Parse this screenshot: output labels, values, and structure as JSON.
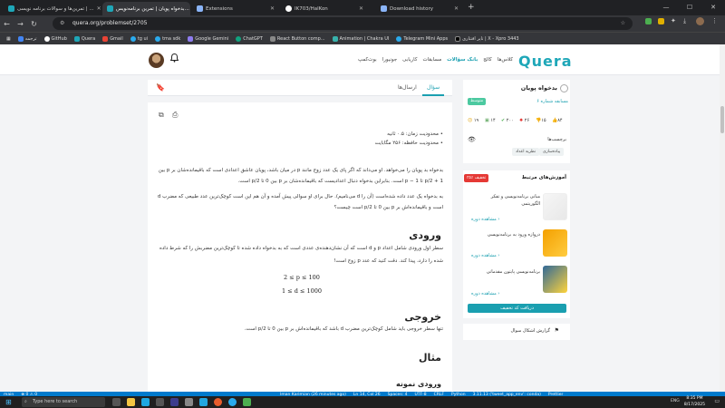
{
  "browser": {
    "tabs": [
      {
        "title": "تمرین‌ها و سوالات برنامه نویسی | ...",
        "color": "#1ea7b8"
      },
      {
        "title": "بدخواه پویان | تمرین برنامه‌نویس...",
        "color": "#1ea7b8"
      },
      {
        "title": "Extensions",
        "color": "#8ab4f8"
      },
      {
        "title": "IK703/HalKon",
        "color": "#ffffff"
      },
      {
        "title": "Download history",
        "color": "#8ab4f8"
      }
    ],
    "url": "quera.org/problemset/2705",
    "bookmarks": [
      "ترجمه",
      "GitHub",
      "Quera",
      "Gmail",
      "tg ui",
      "tma sdk",
      "Google Gemini",
      "ChatGPT",
      "React Button comp...",
      "Animation | Chakra UI",
      "Telegram Mini Apps",
      "تاپر افتتاری | X - Xpro 3443"
    ]
  },
  "site": {
    "logo": "Quera",
    "nav": [
      "کلاس‌ها",
      "کالج",
      "بانک سؤالات",
      "مسابقات",
      "کاریابی",
      "جونیورا",
      "بوت‌کمپ"
    ],
    "active_nav": "بانک سؤالات"
  },
  "problem_tabs": {
    "question": "سؤال",
    "submissions": "ارسال‌ها"
  },
  "problem": {
    "limits": [
      "محدودیت زمان: ۰.۵ ثانیه",
      "محدودیت حافظه: ۲۵۶ مگابایت"
    ],
    "statement_1": "بدخواه بد پویان را می‌خواهد. او می‌داند که اگر پای یک عدد زوج مانند p در میان باشد، پویان عاشق اعدادی است که باقیمانده‌شان بر p بین",
    "statement_1b": "1 + p/2 تا p − 1 است. بنابراین بدخواه دنبال اعدادیست که باقیمانده‌شان بر p بین 0 تا p/2 است.",
    "statement_2": "به بدخواه یک عدد داده شده‌است (آن را d می‌نامیم). حال برای او سوالی پیش آمده و آن هم این است کوچک‌ترین عدد طبیعی که مضرب d",
    "statement_2b": "است و باقیمانده‌اش بر p بین 0 تا p/2 است چیست؟",
    "input_title": "ورودی",
    "input_text": "سطر اول ورودی شامل اعداد p و d است که آن نشان‌دهنده‌ی عددی است که به بدخواه داده شده تا کوچک‌ترین مضربش را که شرط داده",
    "input_text_b": "شده را دارد، پیدا کند. دقت کنید که عدد p زوج است!",
    "constraint_1": "2 ≤ p ≤ 100",
    "constraint_2": "1 ≤ d ≤ 1000",
    "output_title": "خروجی",
    "output_text": "تنها سطر خروجی باید شامل کوچک‌ترین مضرب d باشد که باقیمانده‌اش بر p بین 0 تا p/2 است.",
    "example_title": "مثال",
    "sample_input_title": "ورودی نمونه"
  },
  "sidebar": {
    "problem_title": "بدخواه پویان",
    "contest": "مسابقه شماره ۶",
    "difficulty_badge": "متوسط",
    "stats": {
      "likes": "۸۴",
      "dislikes": "۱۵",
      "rating": "۲۶",
      "solved": "۲۰۰",
      "attempts": "۱۴",
      "reports": "۱۹"
    },
    "tags_title": "برچسب‌ها",
    "tags": [
      "نظریه اعداد",
      "پیاده‌سازی"
    ],
    "courses_title": "آموزش‌های مرتبط",
    "discount_badge": "۳۵٪ تخفیف",
    "courses": [
      {
        "title": "مبانی برنامه‌نویسی و تفکر الگوریتمی",
        "link": "مشاهده دوره"
      },
      {
        "title": "دروازه ورود به برنامه‌نویسی",
        "link": "مشاهده دوره"
      },
      {
        "title": "برنامه‌نویسی پایتون مقدماتی",
        "link": "مشاهده دوره"
      }
    ],
    "discount_button": "دریافت کد تخفیف",
    "report": "گزارش اشکال سوال"
  },
  "statusbar": [
    "main",
    "⊗ 0 ⚠ 0",
    "Iman Karimian (26 minutes ago)",
    "Ln 14, Col 26",
    "Spaces: 4",
    "UTF-8",
    "CRLF",
    "Python",
    "3.11.13 ('tweet_app_env': conda)",
    "Prettier"
  ],
  "taskbar": {
    "search": "Type here to search",
    "time": "8:35 PM",
    "date": "8/17/2025",
    "lang": "ENG"
  }
}
